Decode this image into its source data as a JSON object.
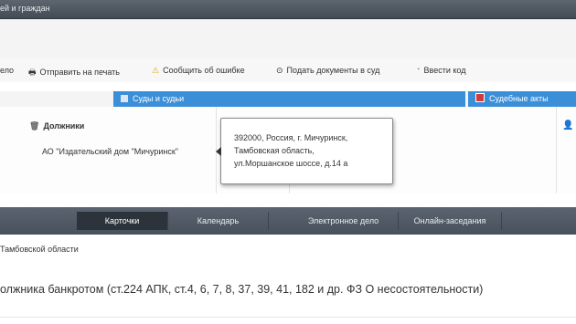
{
  "topbar": {
    "title": "ей и граждан"
  },
  "toolbar": {
    "items": [
      {
        "label": "ело",
        "icon": ""
      },
      {
        "label": "Отправить на печать",
        "icon": "printer-icon"
      },
      {
        "label": "Сообщить об ошибке",
        "icon": "warning-icon"
      },
      {
        "label": "Подать документы в суд",
        "icon": "upload-icon"
      },
      {
        "label": "Ввести код",
        "icon": "code-icon"
      }
    ]
  },
  "tabs": {
    "courts": "Суды и судьи",
    "judicial_acts": "Судебные акты"
  },
  "debtors": {
    "heading": "Должники",
    "items": [
      "АО \"Издательский дом \"Мичуринск\""
    ]
  },
  "tooltip": {
    "lines": [
      "392000, Россия, г. Мичуринск,",
      "Тамбовская область,",
      "ул.Моршанское шоссе, д.14 а"
    ]
  },
  "nav": {
    "items": [
      "Карточки",
      "Календарь",
      "Электронное дело",
      "Онлайн-заседания"
    ],
    "active": "Карточки"
  },
  "breadcrumb": "Тамбовской области",
  "heading": "олжника банкротом (ст.224 АПК, ст.4, 6, 7, 8, 37, 39, 41, 182 и др. ФЗ О несостоятельности)",
  "colors": {
    "accent": "#3b8fd9",
    "navbar": "#4f5863",
    "alert": "#d23b3b"
  }
}
